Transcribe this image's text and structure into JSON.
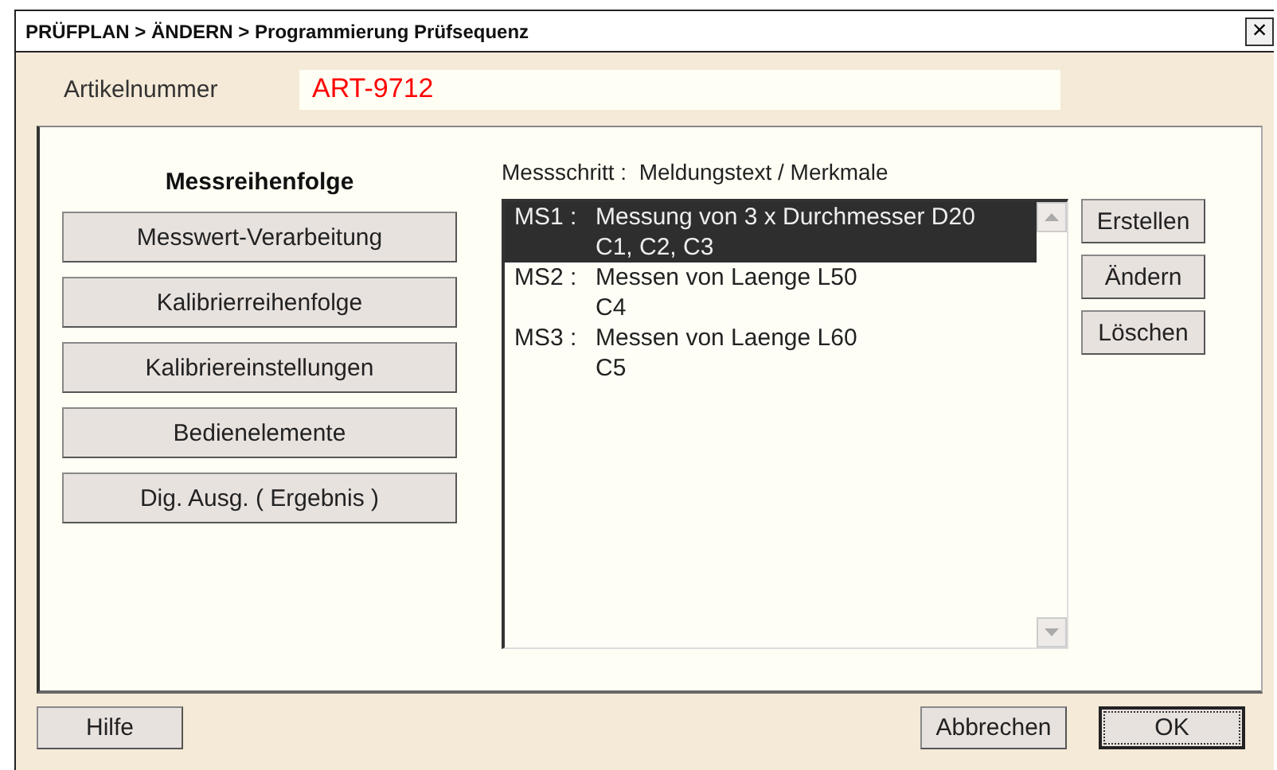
{
  "window": {
    "title": "PRÜFPLAN > ÄNDERN > Programmierung Prüfsequenz",
    "close": "×"
  },
  "article": {
    "label": "Artikelnummer",
    "value": "ART-9712"
  },
  "sequence": {
    "heading": "Messreihenfolge",
    "buttons": [
      "Messwert-Verarbeitung",
      "Kalibrierreihenfolge",
      "Kalibriereinstellungen",
      "Bedienelemente",
      "Dig. Ausg. ( Ergebnis )"
    ]
  },
  "steps": {
    "header": "Messschritt :  Meldungstext / Merkmale",
    "items": [
      {
        "id": "MS1 :",
        "text": "Messung von 3 x Durchmesser D20",
        "features": "C1, C2, C3",
        "selected": true
      },
      {
        "id": "MS2 :",
        "text": "Messen von Laenge L50",
        "features": "C4",
        "selected": false
      },
      {
        "id": "MS3 :",
        "text": "Messen von Laenge L60",
        "features": "C5",
        "selected": false
      }
    ],
    "actions": [
      "Erstellen",
      "Ändern",
      "Löschen"
    ]
  },
  "footer": {
    "help": "Hilfe",
    "cancel": "Abbrechen",
    "ok": "OK"
  }
}
